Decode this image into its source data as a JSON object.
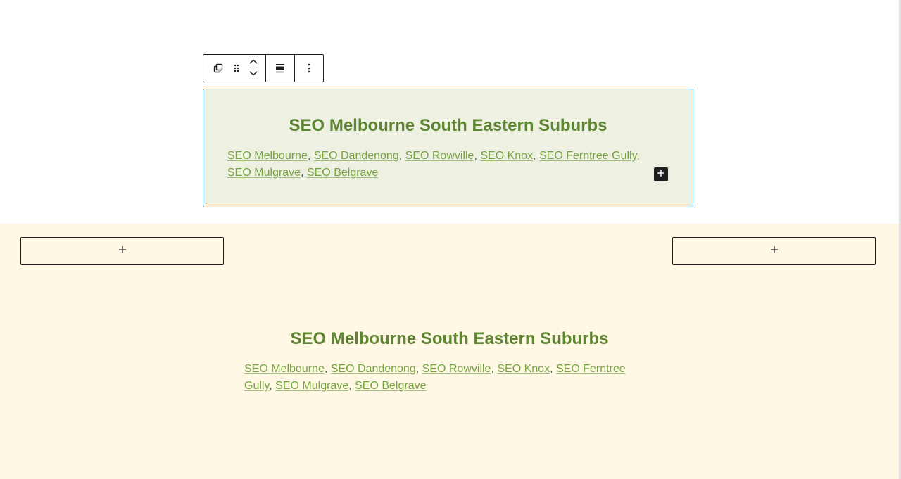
{
  "toolbar": {
    "buttons": [
      "select-parent-icon",
      "drag-handle-icon",
      "move-up-icon",
      "move-down-icon",
      "align-icon",
      "more-options-icon"
    ]
  },
  "selected_block": {
    "title": "SEO Melbourne South Eastern Suburbs",
    "links": [
      "SEO Melbourne",
      "SEO Dandenong",
      "SEO Rowville",
      "SEO Knox",
      "SEO Ferntree Gully",
      "SEO Mulgrave",
      "SEO Belgrave"
    ],
    "separator": ","
  },
  "cream_block": {
    "title": "SEO Melbourne South Eastern Suburbs",
    "links": [
      "SEO Melbourne",
      "SEO Dandenong",
      "SEO Rowville",
      "SEO Knox",
      "SEO Ferntree Gully",
      "SEO Mulgrave",
      "SEO Belgrave"
    ],
    "separator": ","
  },
  "colors": {
    "title_green": "#5e8531",
    "link_green": "#75a43f",
    "selection_border": "#0b5f99",
    "selected_bg": "#eef0e2",
    "cream_bg": "#fef8e4"
  }
}
